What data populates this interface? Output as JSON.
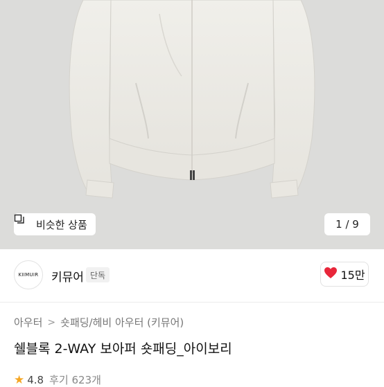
{
  "hero": {
    "similar_label": "비슷한 상품",
    "similar_icon": "similar-items-icon",
    "pager": "1 / 9"
  },
  "brand": {
    "logo_text": "KIIMUIR",
    "name": "키뮤어",
    "tag": "단독",
    "like_count": "15만",
    "like_icon": "heart-icon",
    "like_color": "#e8263a"
  },
  "breadcrumb": {
    "items": [
      "아우터",
      "숏패딩/헤비 아우터 (키뮤어)"
    ],
    "separator_icon": "chevron-right-icon"
  },
  "product": {
    "title": "쉘블록 2-WAY 보아퍼 숏패딩_아이보리",
    "rating": "4.8",
    "review_count": "후기 623개",
    "star_color": "#f5a623"
  },
  "colors": {
    "image_background": "#dcdcda",
    "jacket": "#ecebe6"
  }
}
